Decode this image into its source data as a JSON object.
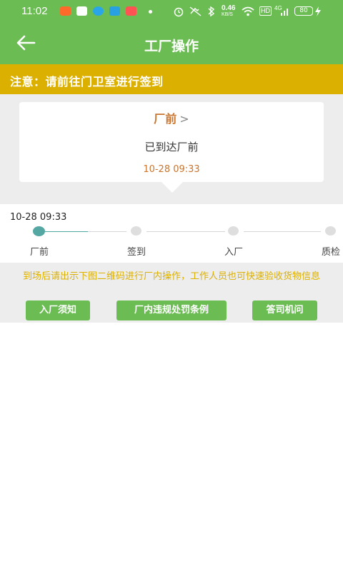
{
  "status_bar": {
    "time": "11:02",
    "network_speed": "0.46",
    "network_unit": "KB/S",
    "hd": "HD",
    "signal": "4G",
    "battery": "80"
  },
  "nav": {
    "title": "工厂操作"
  },
  "notice": {
    "text": "注意：请前往门卫室进行签到"
  },
  "status_card": {
    "title": "厂前",
    "chevron": ">",
    "status": "已到达厂前",
    "time": "10-28 09:33"
  },
  "steps": {
    "time": "10-28 09:33",
    "items": [
      {
        "label": "厂前",
        "active": true
      },
      {
        "label": "签到",
        "active": false
      },
      {
        "label": "入厂",
        "active": false
      },
      {
        "label": "质检",
        "active": false
      }
    ]
  },
  "actions": {
    "instruction": "到场后请出示下图二维码进行厂内操作，工作人员也可快速验收货物信息",
    "buttons": [
      {
        "label": "入厂须知"
      },
      {
        "label": "厂内违规处罚条例"
      },
      {
        "label": "答司机问"
      }
    ]
  },
  "colors": {
    "primary_green": "#6bbd53",
    "notice_yellow": "#dcb000",
    "accent_orange": "#c8752f",
    "step_teal": "#55a7a3"
  }
}
